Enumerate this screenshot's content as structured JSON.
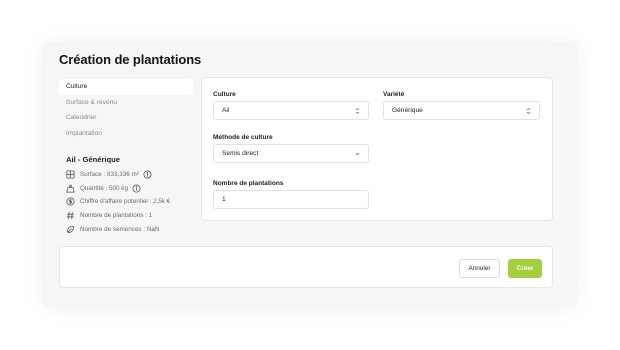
{
  "modal": {
    "title": "Création de plantations"
  },
  "nav": {
    "items": [
      {
        "label": "Culture",
        "active": true
      },
      {
        "label": "Surface & revenu",
        "active": false
      },
      {
        "label": "Calendrier",
        "active": false
      },
      {
        "label": "Implantation",
        "active": false
      }
    ]
  },
  "summary": {
    "title": "Ail - Générique",
    "surface": "Surface : 833,336 m²",
    "quantite": "Quantité : 500 kg",
    "chiffre": "Chiffre d'affaire potentiel : 2,5k €",
    "nb_plantations": "Nombre de plantations : 1",
    "nb_semences": "Nombre de semences : NaN"
  },
  "form": {
    "culture_label": "Culture",
    "culture_value": "Ail",
    "variete_label": "Variété",
    "variete_value": "Générique",
    "methode_label": "Méthode de culture",
    "methode_value": "Semis direct",
    "nombre_label": "Nombre de plantations",
    "nombre_value": "1"
  },
  "footer": {
    "cancel_label": "Annuler",
    "create_label": "Créer"
  },
  "colors": {
    "accent": "#a4cf3e",
    "background": "#f6f6f6"
  },
  "icons": [
    "grid-icon",
    "scale-icon",
    "dollar-circle-icon",
    "hash-icon",
    "seed-icon",
    "info-icon",
    "chevron-updown-icon",
    "chevron-down-icon"
  ]
}
